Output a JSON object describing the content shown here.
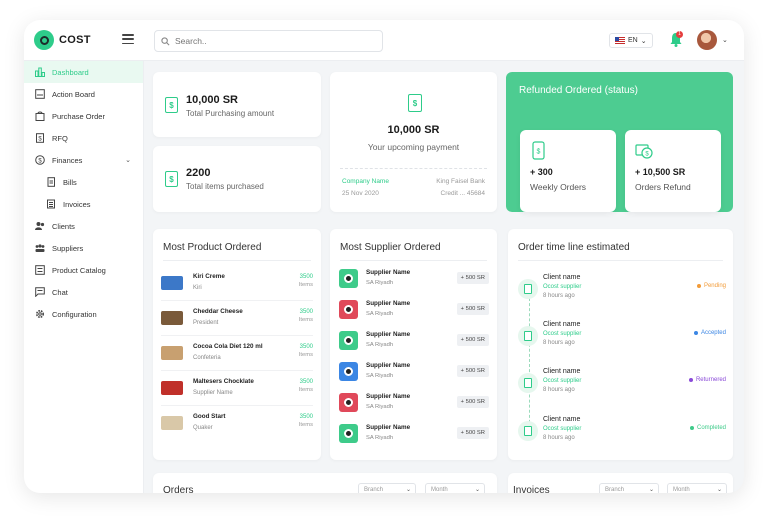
{
  "app": {
    "logo_text": "COST"
  },
  "header": {
    "search_placeholder": "Search..",
    "language": "EN",
    "notification_count": "1"
  },
  "sidebar": {
    "items": [
      {
        "label": "Dashboard",
        "icon": "dashboard-icon"
      },
      {
        "label": "Action Board",
        "icon": "action-board-icon"
      },
      {
        "label": "Purchase Order",
        "icon": "purchase-order-icon"
      },
      {
        "label": "RFQ",
        "icon": "rfq-icon"
      },
      {
        "label": "Finances",
        "icon": "finances-icon"
      },
      {
        "label": "Bills",
        "icon": "bills-icon"
      },
      {
        "label": "Invoices",
        "icon": "invoices-icon"
      },
      {
        "label": "Clients",
        "icon": "clients-icon"
      },
      {
        "label": "Suppliers",
        "icon": "suppliers-icon"
      },
      {
        "label": "Product Catalog",
        "icon": "product-catalog-icon"
      },
      {
        "label": "Chat",
        "icon": "chat-icon"
      },
      {
        "label": "Configuration",
        "icon": "configuration-icon"
      }
    ]
  },
  "stats": {
    "purchasing": {
      "value": "10,000 SR",
      "label": "Total Purchasing amount"
    },
    "items": {
      "value": "2200",
      "label": "Total items purchased"
    },
    "upcoming": {
      "value": "10,000 SR",
      "label": "Your upcoming payment",
      "company": "Company Name",
      "bank": "King Faisel Bank",
      "date": "25 Nov 2020",
      "credit": "Credit ... 45684"
    }
  },
  "refunded": {
    "title": "Refunded Ordered (status)",
    "weekly": {
      "value": "+ 300",
      "label": "Weekly Orders"
    },
    "refund": {
      "value": "+ 10,500 SR",
      "label": "Orders Refund"
    }
  },
  "most_product": {
    "title": "Most Product Ordered",
    "items": [
      {
        "name": "Kiri Creme",
        "brand": "Kiri",
        "qty": "3500",
        "unit": "Items",
        "color": "#3c78c8"
      },
      {
        "name": "Cheddar Cheese",
        "brand": "President",
        "qty": "3500",
        "unit": "Items",
        "color": "#7a5a3a"
      },
      {
        "name": "Cocoa Cola Diet 120 ml",
        "brand": "Confeteria",
        "qty": "3500",
        "unit": "Items",
        "color": "#c8a070"
      },
      {
        "name": "Maltesers Chocklate",
        "brand": "Supplier Name",
        "qty": "3500",
        "unit": "Items",
        "color": "#c0302a"
      },
      {
        "name": "Good Start",
        "brand": "Quaker",
        "qty": "3500",
        "unit": "Items",
        "color": "#d9c8a8"
      }
    ]
  },
  "most_supplier": {
    "title": "Most Supplier Ordered",
    "items": [
      {
        "name": "Supplier Name",
        "city": "SA Riyadh",
        "amount": "+ 500 SR",
        "color": "#3ecb8a"
      },
      {
        "name": "Supplier Name",
        "city": "SA Riyadh",
        "amount": "+ 500 SR",
        "color": "#e0495a"
      },
      {
        "name": "Supplier Name",
        "city": "SA Riyadh",
        "amount": "+ 500 SR",
        "color": "#3ecb8a"
      },
      {
        "name": "Supplier Name",
        "city": "SA Riyadh",
        "amount": "+ 500 SR",
        "color": "#3b86e4"
      },
      {
        "name": "Supplier Name",
        "city": "SA Riyadh",
        "amount": "+ 500 SR",
        "color": "#e0495a"
      },
      {
        "name": "Supplier Name",
        "city": "SA Riyadh",
        "amount": "+ 500 SR",
        "color": "#3ecb8a"
      }
    ]
  },
  "timeline": {
    "title": "Order time line estimated",
    "items": [
      {
        "client": "Client name",
        "supplier": "Ocost supplier",
        "time": "8 hours ago",
        "status": "Pending",
        "color": "#f29b38"
      },
      {
        "client": "Client name",
        "supplier": "Ocost supplier",
        "time": "8 hours ago",
        "status": "Accepted",
        "color": "#3b86e4"
      },
      {
        "client": "Client name",
        "supplier": "Ocost supplier",
        "time": "8 hours ago",
        "status": "Returnered",
        "color": "#8a4ad8"
      },
      {
        "client": "Client name",
        "supplier": "Ocost supplier",
        "time": "8 hours ago",
        "status": "Completed",
        "color": "#3ecb8a"
      }
    ]
  },
  "bottom": {
    "orders": "Orders",
    "invoices": "Invoices",
    "branch": "Branch",
    "month": "Month",
    "branch2": "Branch",
    "month2": "Month"
  }
}
